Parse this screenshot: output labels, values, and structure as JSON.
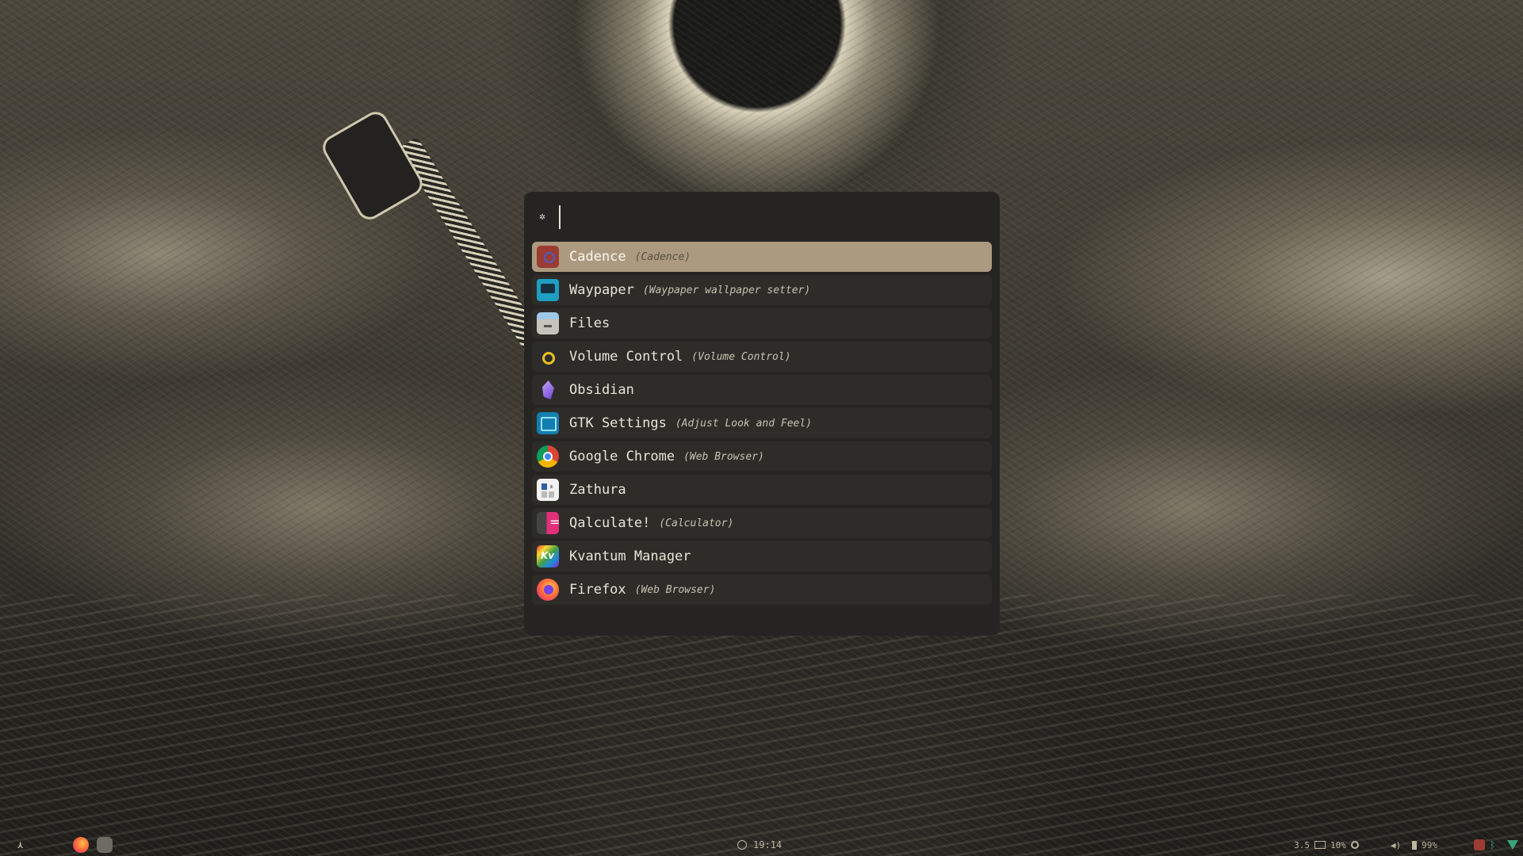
{
  "launcher": {
    "search": {
      "value": "",
      "placeholder": ""
    },
    "icon": "gear-icon",
    "items": [
      {
        "name": "Cadence",
        "desc": "(Cadence)",
        "icon": "cadence-icon",
        "selected": true
      },
      {
        "name": "Waypaper",
        "desc": "(Waypaper wallpaper setter)",
        "icon": "waypaper-icon"
      },
      {
        "name": "Files",
        "desc": "",
        "icon": "files-icon"
      },
      {
        "name": "Volume Control",
        "desc": "(Volume Control)",
        "icon": "volume-control-icon"
      },
      {
        "name": "Obsidian",
        "desc": "",
        "icon": "obsidian-icon"
      },
      {
        "name": "GTK Settings",
        "desc": "(Adjust Look and Feel)",
        "icon": "gtk-settings-icon"
      },
      {
        "name": "Google Chrome",
        "desc": "(Web Browser)",
        "icon": "google-chrome-icon"
      },
      {
        "name": "Zathura",
        "desc": "",
        "icon": "zathura-icon"
      },
      {
        "name": "Qalculate!",
        "desc": "(Calculator)",
        "icon": "qalculate-icon"
      },
      {
        "name": "Kvantum Manager",
        "desc": "",
        "icon": "kvantum-manager-icon"
      },
      {
        "name": "Firefox",
        "desc": "(Web Browser)",
        "icon": "firefox-icon"
      }
    ]
  },
  "taskbar": {
    "clock": "19:14",
    "keyboard_layout": "3.5",
    "cpu": "10%",
    "battery": "99%"
  },
  "colors": {
    "launcher_bg": "#252422",
    "item_bg": "#2d2c29",
    "selected_bg": "#ac9a80",
    "text": "#e9e4d6"
  }
}
